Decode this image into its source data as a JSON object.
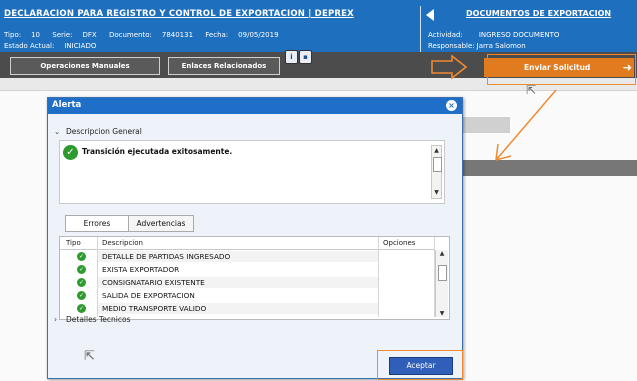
{
  "header": {
    "title": "DECLARACION PARA REGISTRO Y CONTROL DE EXPORTACION | DEPREX",
    "tipo_label": "Tipo:",
    "tipo_value": "10",
    "serie_label": "Serie:",
    "serie_value": "DFX",
    "documento_label": "Documento:",
    "documento_value": "7840131",
    "fecha_label": "Fecha:",
    "fecha_value": "09/05/2019",
    "estado_label": "Estado Actual:",
    "estado_value": "INICIADO",
    "right_title": "DOCUMENTOS DE EXPORTACION",
    "actividad_label": "Actividad:",
    "actividad_value": "INGRESO DOCUMENTO",
    "responsable_label": "Responsable:",
    "responsable_value": "Jarra Salomon"
  },
  "toolbar": {
    "operaciones_label": "Operaciones Manuales",
    "enlaces_label": "Enlaces Relacionados",
    "enviar_label": "Enviar Solicitud",
    "enviar_arrow": "➜"
  },
  "dialog": {
    "title": "Alerta",
    "close_glyph": "×",
    "general_section": "Descripcion General",
    "message": "Transición ejecutada exitosamente.",
    "tabs": [
      "Errores",
      "Advertencias"
    ],
    "columns": [
      "Tipo",
      "Descripcion",
      "Opciones"
    ],
    "rows": [
      {
        "descripcion": "DETALLE DE PARTIDAS INGRESADO"
      },
      {
        "descripcion": "EXISTA EXPORTADOR"
      },
      {
        "descripcion": "CONSIGNATARIO EXISTENTE"
      },
      {
        "descripcion": "SALIDA DE EXPORTACION"
      },
      {
        "descripcion": "MEDIO TRANSPORTE VALIDO"
      }
    ],
    "details_section": "Detalles Tecnicos",
    "accept_label": "Aceptar"
  },
  "colors": {
    "header_blue": "#1f6fbf",
    "dark_bar": "#4c4c4c",
    "accent_orange": "#e07b20",
    "success_green": "#2c9a2c",
    "dialog_blue": "#1f6fc9"
  },
  "icons": [
    "back-triangle-icon",
    "info-square-icon",
    "doc-square-icon",
    "cursor-arrow-icon",
    "check-circle-icon",
    "chevron-down-icon",
    "chevron-right-icon",
    "close-icon",
    "scroll-up-icon",
    "scroll-down-icon",
    "orange-annotation-arrow-icon"
  ]
}
